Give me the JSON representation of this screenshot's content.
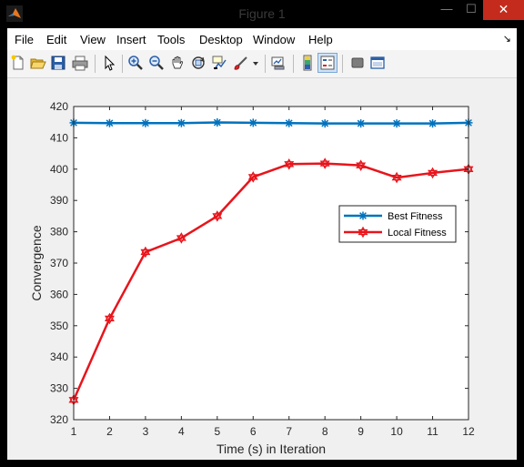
{
  "window": {
    "title": "Figure 1",
    "controls": {
      "minimize": "—",
      "maximize": "☐",
      "close": "✕"
    }
  },
  "menubar": {
    "items": [
      "File",
      "Edit",
      "View",
      "Insert",
      "Tools",
      "Desktop",
      "Window",
      "Help"
    ]
  },
  "toolbar": {
    "buttons": [
      "new-figure-icon",
      "open-file-icon",
      "save-icon",
      "print-icon",
      "edit-plot-icon",
      "zoom-in-icon",
      "zoom-out-icon",
      "pan-icon",
      "rotate-3d-icon",
      "data-cursor-icon",
      "brush-icon",
      "link-plot-icon",
      "insert-colorbar-icon",
      "insert-legend-icon",
      "hide-plot-tools-icon",
      "show-plot-tools-icon"
    ]
  },
  "colors": {
    "best": "#0072bd",
    "local": "#e8141b"
  },
  "chart_data": {
    "type": "line",
    "x": [
      1,
      2,
      3,
      4,
      5,
      6,
      7,
      8,
      9,
      10,
      11,
      12
    ],
    "xlabel": "Time (s) in Iteration",
    "ylabel": "Convergence",
    "xlim": [
      1,
      12
    ],
    "ylim": [
      320,
      420
    ],
    "xticks": [
      "1",
      "2",
      "3",
      "4",
      "5",
      "6",
      "7",
      "8",
      "9",
      "10",
      "11",
      "12"
    ],
    "yticks": [
      "320",
      "330",
      "340",
      "350",
      "360",
      "370",
      "380",
      "390",
      "400",
      "410",
      "420"
    ],
    "grid": false,
    "legend_position": "right",
    "series": [
      {
        "name": "Best Fitness",
        "marker": "asterisk",
        "values": [
          414.8,
          414.7,
          414.7,
          414.7,
          414.9,
          414.8,
          414.7,
          414.6,
          414.6,
          414.6,
          414.6,
          414.8
        ]
      },
      {
        "name": "Local Fitness",
        "marker": "hexagram",
        "values": [
          326.3,
          352.3,
          373.5,
          378.0,
          385.0,
          397.5,
          401.6,
          401.8,
          401.2,
          397.3,
          398.8,
          400.0
        ]
      }
    ]
  }
}
